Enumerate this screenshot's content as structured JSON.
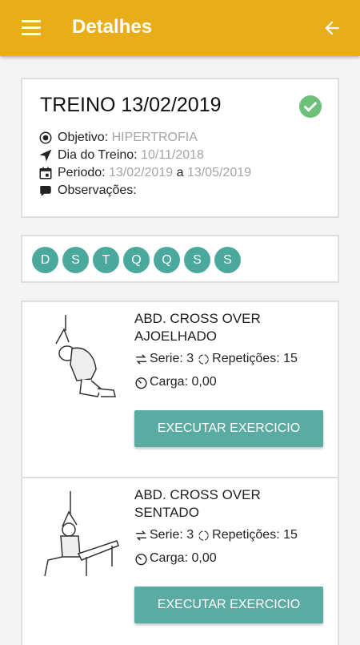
{
  "header": {
    "title": "Detalhes",
    "menu_icon": "menu-icon",
    "back_icon": "arrow-left-icon",
    "color": "#e9ad1a"
  },
  "treino": {
    "title": "TREINO 13/02/2019",
    "status_icon": "check-circle-icon",
    "objetivo_label": "Objetivo:",
    "objetivo_value": "HIPERTROFIA",
    "dia_label": "Dia do Treino:",
    "dia_value": "10/11/2018",
    "periodo_label": "Periodo:",
    "periodo_start": "13/02/2019",
    "periodo_sep": "a",
    "periodo_end": "13/05/2019",
    "obs_label": "Observações:"
  },
  "days": [
    "D",
    "S",
    "T",
    "Q",
    "Q",
    "S",
    "S"
  ],
  "exercises": [
    {
      "name": "ABD. CROSS OVER AJOELHADO",
      "serie": "Serie: 3",
      "repeticoes": "Repetições: 15",
      "carga": "Carga: 0,00",
      "button": "EXECUTAR EXERCICIO"
    },
    {
      "name": "ABD. CROSS OVER SENTADO",
      "serie": "Serie: 3",
      "repeticoes": "Repetições: 15",
      "carga": "Carga: 0,00",
      "button": "EXECUTAR EXERCICIO"
    }
  ],
  "accent": "#5aaba1"
}
